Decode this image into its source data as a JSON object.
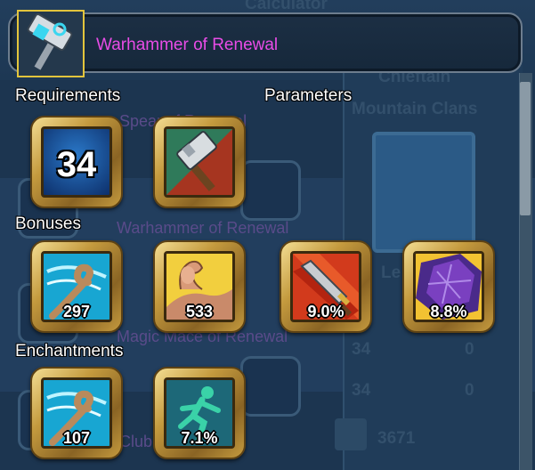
{
  "item": {
    "name": "Warhammer of Renewal",
    "name_color": "#e84ce6",
    "icon": "warhammer-icon"
  },
  "sections": {
    "requirements": "Requirements",
    "parameters": "Parameters",
    "bonuses": "Bonuses",
    "enchantments": "Enchantments"
  },
  "requirements": {
    "level": "34",
    "weapon_type_icon": "hammer-icon"
  },
  "bonuses": [
    {
      "icon": "whirlwind-icon",
      "value": "297"
    },
    {
      "icon": "flexed-arm-icon",
      "value": "533"
    },
    {
      "icon": "sword-slash-icon",
      "value": "9.0%"
    },
    {
      "icon": "shattered-shield-icon",
      "value": "8.8%"
    }
  ],
  "enchantments": [
    {
      "icon": "whirlwind-icon",
      "value": "107"
    },
    {
      "icon": "running-man-icon",
      "value": "7.1%"
    }
  ],
  "background": {
    "labels": [
      "Calculator",
      "Chieftain",
      "Mountain Clans",
      "Spear of Renewal",
      "Warhammer of Renewal",
      "Magic Mace of Renewal",
      "Club"
    ],
    "stats": [
      "34",
      "0",
      "34",
      "0",
      "3671"
    ],
    "level_prefix": "Le"
  },
  "colors": {
    "slot_gold": "#c49a3e",
    "header_border": "#6d7d8e",
    "icon_frame": "#e3c53c"
  }
}
